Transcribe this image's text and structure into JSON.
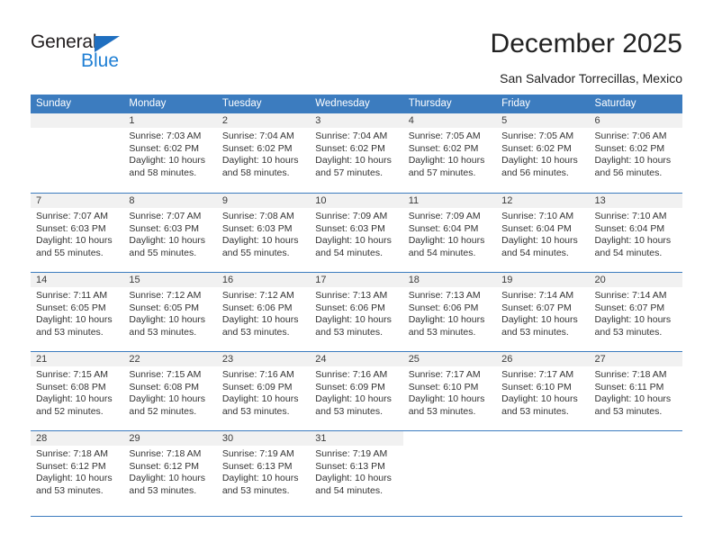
{
  "brand": {
    "name_part1": "General",
    "name_part2": "Blue",
    "accent_color": "#1f7fd4",
    "header_color": "#3c7cbf"
  },
  "header": {
    "title": "December 2025",
    "subtitle": "San Salvador Torrecillas, Mexico"
  },
  "calendar": {
    "weekday_headers": [
      "Sunday",
      "Monday",
      "Tuesday",
      "Wednesday",
      "Thursday",
      "Friday",
      "Saturday"
    ],
    "weeks": [
      [
        {
          "day": "",
          "sunrise": "",
          "sunset": "",
          "daylight_line1": "",
          "daylight_line2": "",
          "blank": true
        },
        {
          "day": "1",
          "sunrise": "Sunrise: 7:03 AM",
          "sunset": "Sunset: 6:02 PM",
          "daylight_line1": "Daylight: 10 hours",
          "daylight_line2": "and 58 minutes."
        },
        {
          "day": "2",
          "sunrise": "Sunrise: 7:04 AM",
          "sunset": "Sunset: 6:02 PM",
          "daylight_line1": "Daylight: 10 hours",
          "daylight_line2": "and 58 minutes."
        },
        {
          "day": "3",
          "sunrise": "Sunrise: 7:04 AM",
          "sunset": "Sunset: 6:02 PM",
          "daylight_line1": "Daylight: 10 hours",
          "daylight_line2": "and 57 minutes."
        },
        {
          "day": "4",
          "sunrise": "Sunrise: 7:05 AM",
          "sunset": "Sunset: 6:02 PM",
          "daylight_line1": "Daylight: 10 hours",
          "daylight_line2": "and 57 minutes."
        },
        {
          "day": "5",
          "sunrise": "Sunrise: 7:05 AM",
          "sunset": "Sunset: 6:02 PM",
          "daylight_line1": "Daylight: 10 hours",
          "daylight_line2": "and 56 minutes."
        },
        {
          "day": "6",
          "sunrise": "Sunrise: 7:06 AM",
          "sunset": "Sunset: 6:02 PM",
          "daylight_line1": "Daylight: 10 hours",
          "daylight_line2": "and 56 minutes."
        }
      ],
      [
        {
          "day": "7",
          "sunrise": "Sunrise: 7:07 AM",
          "sunset": "Sunset: 6:03 PM",
          "daylight_line1": "Daylight: 10 hours",
          "daylight_line2": "and 55 minutes."
        },
        {
          "day": "8",
          "sunrise": "Sunrise: 7:07 AM",
          "sunset": "Sunset: 6:03 PM",
          "daylight_line1": "Daylight: 10 hours",
          "daylight_line2": "and 55 minutes."
        },
        {
          "day": "9",
          "sunrise": "Sunrise: 7:08 AM",
          "sunset": "Sunset: 6:03 PM",
          "daylight_line1": "Daylight: 10 hours",
          "daylight_line2": "and 55 minutes."
        },
        {
          "day": "10",
          "sunrise": "Sunrise: 7:09 AM",
          "sunset": "Sunset: 6:03 PM",
          "daylight_line1": "Daylight: 10 hours",
          "daylight_line2": "and 54 minutes."
        },
        {
          "day": "11",
          "sunrise": "Sunrise: 7:09 AM",
          "sunset": "Sunset: 6:04 PM",
          "daylight_line1": "Daylight: 10 hours",
          "daylight_line2": "and 54 minutes."
        },
        {
          "day": "12",
          "sunrise": "Sunrise: 7:10 AM",
          "sunset": "Sunset: 6:04 PM",
          "daylight_line1": "Daylight: 10 hours",
          "daylight_line2": "and 54 minutes."
        },
        {
          "day": "13",
          "sunrise": "Sunrise: 7:10 AM",
          "sunset": "Sunset: 6:04 PM",
          "daylight_line1": "Daylight: 10 hours",
          "daylight_line2": "and 54 minutes."
        }
      ],
      [
        {
          "day": "14",
          "sunrise": "Sunrise: 7:11 AM",
          "sunset": "Sunset: 6:05 PM",
          "daylight_line1": "Daylight: 10 hours",
          "daylight_line2": "and 53 minutes."
        },
        {
          "day": "15",
          "sunrise": "Sunrise: 7:12 AM",
          "sunset": "Sunset: 6:05 PM",
          "daylight_line1": "Daylight: 10 hours",
          "daylight_line2": "and 53 minutes."
        },
        {
          "day": "16",
          "sunrise": "Sunrise: 7:12 AM",
          "sunset": "Sunset: 6:06 PM",
          "daylight_line1": "Daylight: 10 hours",
          "daylight_line2": "and 53 minutes."
        },
        {
          "day": "17",
          "sunrise": "Sunrise: 7:13 AM",
          "sunset": "Sunset: 6:06 PM",
          "daylight_line1": "Daylight: 10 hours",
          "daylight_line2": "and 53 minutes."
        },
        {
          "day": "18",
          "sunrise": "Sunrise: 7:13 AM",
          "sunset": "Sunset: 6:06 PM",
          "daylight_line1": "Daylight: 10 hours",
          "daylight_line2": "and 53 minutes."
        },
        {
          "day": "19",
          "sunrise": "Sunrise: 7:14 AM",
          "sunset": "Sunset: 6:07 PM",
          "daylight_line1": "Daylight: 10 hours",
          "daylight_line2": "and 53 minutes."
        },
        {
          "day": "20",
          "sunrise": "Sunrise: 7:14 AM",
          "sunset": "Sunset: 6:07 PM",
          "daylight_line1": "Daylight: 10 hours",
          "daylight_line2": "and 53 minutes."
        }
      ],
      [
        {
          "day": "21",
          "sunrise": "Sunrise: 7:15 AM",
          "sunset": "Sunset: 6:08 PM",
          "daylight_line1": "Daylight: 10 hours",
          "daylight_line2": "and 52 minutes."
        },
        {
          "day": "22",
          "sunrise": "Sunrise: 7:15 AM",
          "sunset": "Sunset: 6:08 PM",
          "daylight_line1": "Daylight: 10 hours",
          "daylight_line2": "and 52 minutes."
        },
        {
          "day": "23",
          "sunrise": "Sunrise: 7:16 AM",
          "sunset": "Sunset: 6:09 PM",
          "daylight_line1": "Daylight: 10 hours",
          "daylight_line2": "and 53 minutes."
        },
        {
          "day": "24",
          "sunrise": "Sunrise: 7:16 AM",
          "sunset": "Sunset: 6:09 PM",
          "daylight_line1": "Daylight: 10 hours",
          "daylight_line2": "and 53 minutes."
        },
        {
          "day": "25",
          "sunrise": "Sunrise: 7:17 AM",
          "sunset": "Sunset: 6:10 PM",
          "daylight_line1": "Daylight: 10 hours",
          "daylight_line2": "and 53 minutes."
        },
        {
          "day": "26",
          "sunrise": "Sunrise: 7:17 AM",
          "sunset": "Sunset: 6:10 PM",
          "daylight_line1": "Daylight: 10 hours",
          "daylight_line2": "and 53 minutes."
        },
        {
          "day": "27",
          "sunrise": "Sunrise: 7:18 AM",
          "sunset": "Sunset: 6:11 PM",
          "daylight_line1": "Daylight: 10 hours",
          "daylight_line2": "and 53 minutes."
        }
      ],
      [
        {
          "day": "28",
          "sunrise": "Sunrise: 7:18 AM",
          "sunset": "Sunset: 6:12 PM",
          "daylight_line1": "Daylight: 10 hours",
          "daylight_line2": "and 53 minutes."
        },
        {
          "day": "29",
          "sunrise": "Sunrise: 7:18 AM",
          "sunset": "Sunset: 6:12 PM",
          "daylight_line1": "Daylight: 10 hours",
          "daylight_line2": "and 53 minutes."
        },
        {
          "day": "30",
          "sunrise": "Sunrise: 7:19 AM",
          "sunset": "Sunset: 6:13 PM",
          "daylight_line1": "Daylight: 10 hours",
          "daylight_line2": "and 53 minutes."
        },
        {
          "day": "31",
          "sunrise": "Sunrise: 7:19 AM",
          "sunset": "Sunset: 6:13 PM",
          "daylight_line1": "Daylight: 10 hours",
          "daylight_line2": "and 54 minutes."
        },
        {
          "day": "",
          "sunrise": "",
          "sunset": "",
          "daylight_line1": "",
          "daylight_line2": "",
          "void": true
        },
        {
          "day": "",
          "sunrise": "",
          "sunset": "",
          "daylight_line1": "",
          "daylight_line2": "",
          "void": true
        },
        {
          "day": "",
          "sunrise": "",
          "sunset": "",
          "daylight_line1": "",
          "daylight_line2": "",
          "void": true
        }
      ]
    ]
  }
}
